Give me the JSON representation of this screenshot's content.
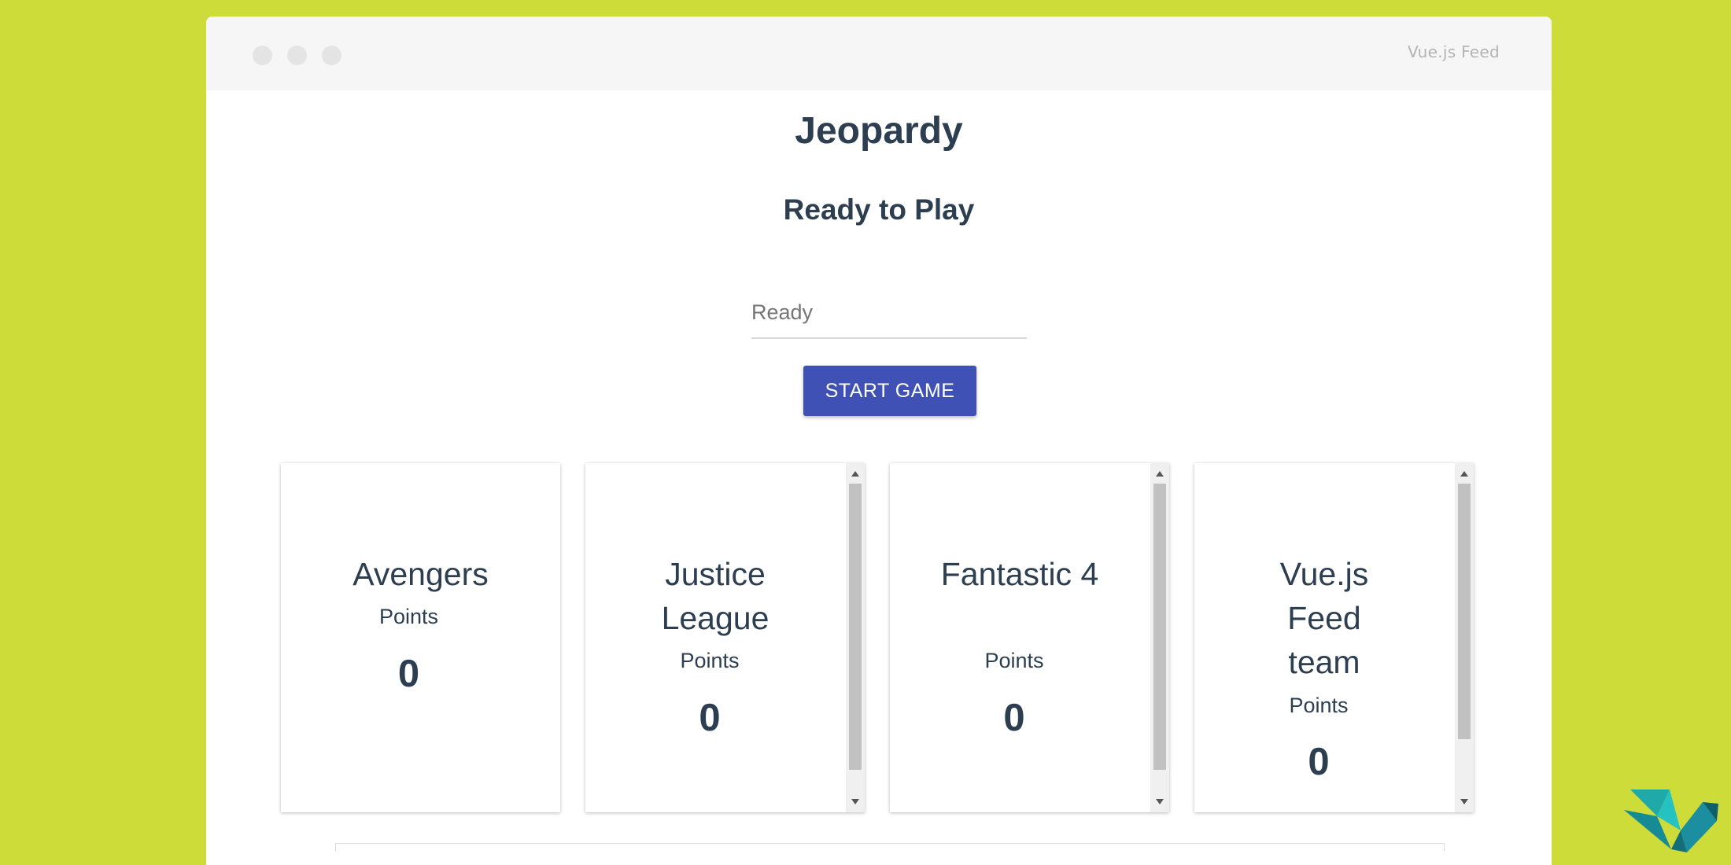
{
  "window": {
    "brand": "Vue.js Feed"
  },
  "game": {
    "title": "Jeopardy",
    "status": "Ready to Play",
    "input": {
      "placeholder": "Ready",
      "value": ""
    },
    "start_button": "START GAME"
  },
  "teams": [
    {
      "name": "Avengers",
      "points_label": "Points",
      "points": "0"
    },
    {
      "name": "Justice League",
      "points_label": "Points",
      "points": "0"
    },
    {
      "name": "Fantastic 4",
      "points_label": "Points",
      "points": "0"
    },
    {
      "name": "Vue.js Feed team",
      "points_label": "Points",
      "points": "0"
    }
  ],
  "colors": {
    "background": "#cddc39",
    "primary_button": "#3f51b5",
    "text": "#2c3e50",
    "logo_teal": "#1fa9a9"
  },
  "icons": {
    "logo": "vuejs-feed-logo-icon"
  }
}
